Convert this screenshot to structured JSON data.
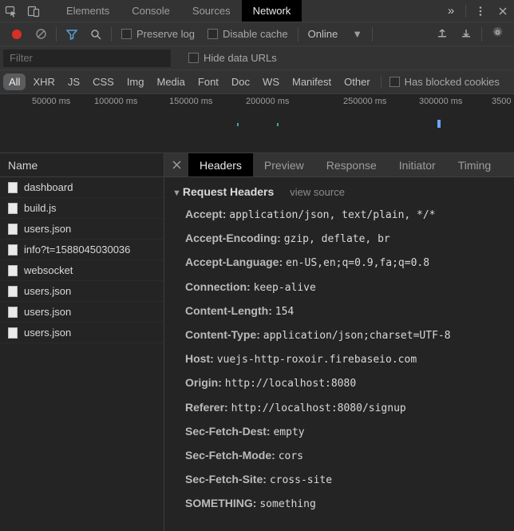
{
  "topTabs": {
    "items": [
      "Elements",
      "Console",
      "Sources",
      "Network"
    ],
    "activeIndex": 3
  },
  "toolbar": {
    "preserveLog": "Preserve log",
    "disableCache": "Disable cache",
    "throttling": "Online"
  },
  "filterBar": {
    "placeholder": "Filter",
    "hideDataUrls": "Hide data URLs"
  },
  "typeFilters": {
    "items": [
      "All",
      "XHR",
      "JS",
      "CSS",
      "Img",
      "Media",
      "Font",
      "Doc",
      "WS",
      "Manifest",
      "Other"
    ],
    "activeIndex": 0,
    "blockedCookies": "Has blocked cookies"
  },
  "timeline": {
    "ticks": [
      "50000 ms",
      "100000 ms",
      "150000 ms",
      "200000 ms",
      "250000 ms",
      "300000 ms",
      "3500"
    ]
  },
  "leftPane": {
    "header": "Name",
    "requests": [
      "dashboard",
      "build.js",
      "users.json",
      "info?t=1588045030036",
      "websocket",
      "users.json",
      "users.json",
      "users.json"
    ]
  },
  "rightPane": {
    "tabs": [
      "Headers",
      "Preview",
      "Response",
      "Initiator",
      "Timing"
    ],
    "activeIndex": 0,
    "sectionTitle": "Request Headers",
    "viewSource": "view source",
    "headers": [
      {
        "k": "Accept",
        "v": "application/json, text/plain, */*"
      },
      {
        "k": "Accept-Encoding",
        "v": "gzip, deflate, br"
      },
      {
        "k": "Accept-Language",
        "v": "en-US,en;q=0.9,fa;q=0.8"
      },
      {
        "k": "Connection",
        "v": "keep-alive"
      },
      {
        "k": "Content-Length",
        "v": "154"
      },
      {
        "k": "Content-Type",
        "v": "application/json;charset=UTF-8"
      },
      {
        "k": "Host",
        "v": "vuejs-http-roxoir.firebaseio.com"
      },
      {
        "k": "Origin",
        "v": "http://localhost:8080"
      },
      {
        "k": "Referer",
        "v": "http://localhost:8080/signup"
      },
      {
        "k": "Sec-Fetch-Dest",
        "v": "empty"
      },
      {
        "k": "Sec-Fetch-Mode",
        "v": "cors"
      },
      {
        "k": "Sec-Fetch-Site",
        "v": "cross-site"
      },
      {
        "k": "SOMETHING",
        "v": "something"
      }
    ]
  }
}
